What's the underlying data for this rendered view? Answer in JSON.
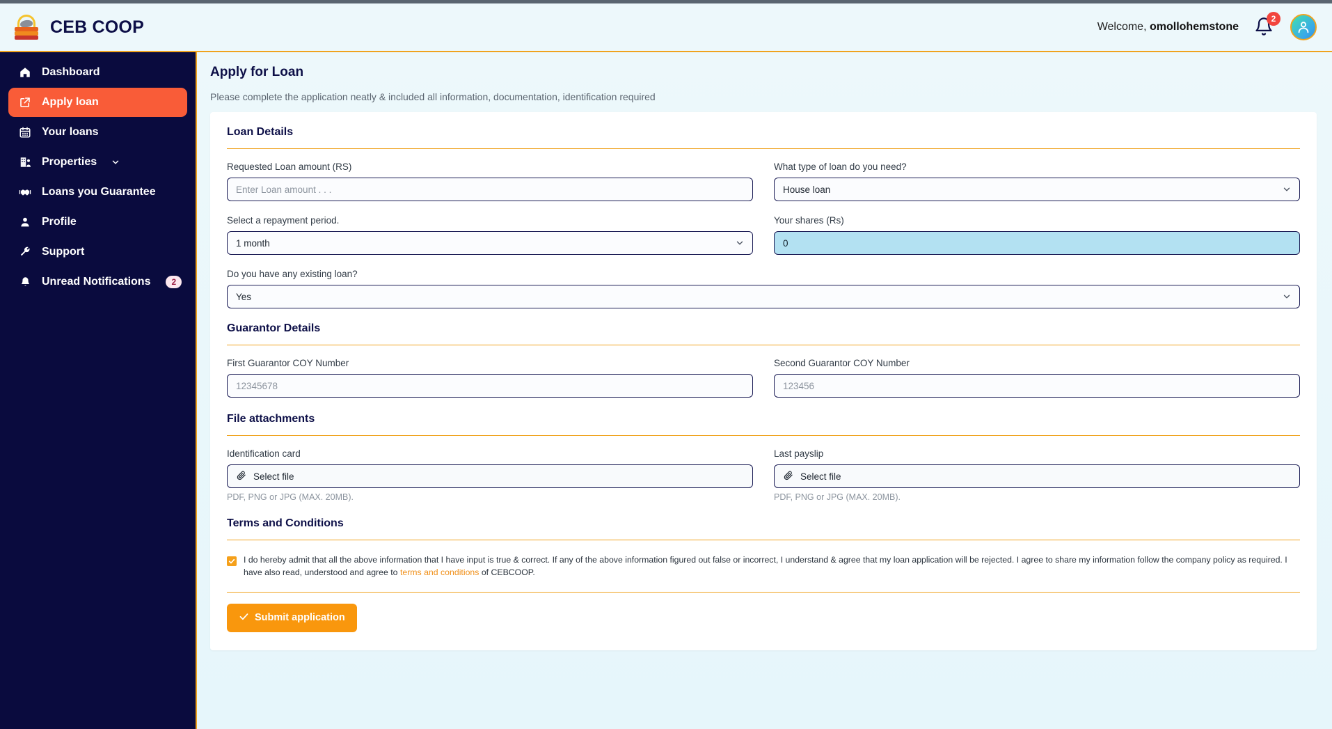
{
  "app": {
    "brand_title": "CEB COOP",
    "logo_icon": "coop-books-logo"
  },
  "header": {
    "welcome_prefix": "Welcome,",
    "username": "omollohemstone",
    "bell_icon": "bell-icon",
    "bell_badge": "2",
    "avatar_icon": "user-avatar"
  },
  "sidebar": {
    "items": [
      {
        "label": "Dashboard",
        "icon": "home-icon",
        "active": false
      },
      {
        "label": "Apply loan",
        "icon": "external-link-icon",
        "active": true
      },
      {
        "label": "Your loans",
        "icon": "calendar-icon",
        "active": false
      },
      {
        "label": "Properties",
        "icon": "building-icon",
        "active": false,
        "chevron": "chevron-down-icon"
      },
      {
        "label": "Loans you Guarantee",
        "icon": "handshake-icon",
        "active": false
      },
      {
        "label": "Profile",
        "icon": "person-icon",
        "active": false
      },
      {
        "label": "Support",
        "icon": "wrench-icon",
        "active": false
      },
      {
        "label": "Unread Notifications",
        "icon": "bell-icon",
        "active": false,
        "badge": "2"
      }
    ]
  },
  "page": {
    "title": "Apply for Loan",
    "subtitle": "Please complete the application neatly & included all information, documentation, identification required"
  },
  "loan_details": {
    "heading": "Loan Details",
    "amount_label": "Requested Loan amount (RS)",
    "amount_placeholder": "Enter Loan amount . . .",
    "amount_value": "",
    "type_label": "What type of loan do you need?",
    "type_value": "House loan",
    "type_options": [
      "House loan"
    ],
    "repayment_label": "Select a repayment period.",
    "repayment_value": "1 month",
    "repayment_options": [
      "1 month"
    ],
    "shares_label": "Your shares (Rs)",
    "shares_value": "0",
    "existing_label": "Do you have any existing loan?",
    "existing_value": "Yes",
    "existing_options": [
      "Yes"
    ]
  },
  "guarantor_details": {
    "heading": "Guarantor Details",
    "first_label": "First Guarantor COY Number",
    "first_placeholder": "12345678",
    "first_value": "",
    "second_label": "Second Guarantor COY Number",
    "second_placeholder": "123456",
    "second_value": ""
  },
  "file_attachments": {
    "heading": "File attachments",
    "id_label": "Identification card",
    "id_button": "Select file",
    "id_help": "PDF, PNG or JPG (MAX. 20MB).",
    "payslip_label": "Last payslip",
    "payslip_button": "Select file",
    "payslip_help": "PDF, PNG or JPG (MAX. 20MB).",
    "attach_icon": "paperclip-icon"
  },
  "terms": {
    "heading": "Terms and Conditions",
    "checked": true,
    "text_before": "I do hereby admit that all the above information that I have input is true & correct. If any of the above information figured out false or incorrect, I understand & agree that my loan application will be rejected. I agree to share my information follow the company policy as required. I have also read, understood and agree to ",
    "link_text": "terms and conditions",
    "text_after": " of CEBCOOP."
  },
  "submit": {
    "label": "Submit application",
    "icon": "check-icon"
  },
  "colors": {
    "sidebar_bg": "#0a0b3e",
    "accent_orange": "#f9970d",
    "active_item": "#f95c38",
    "rule_orange": "#f0a31e",
    "page_bg": "#edf8fb",
    "readonly_field": "#b3e1f2",
    "badge_red": "#f2453d"
  }
}
